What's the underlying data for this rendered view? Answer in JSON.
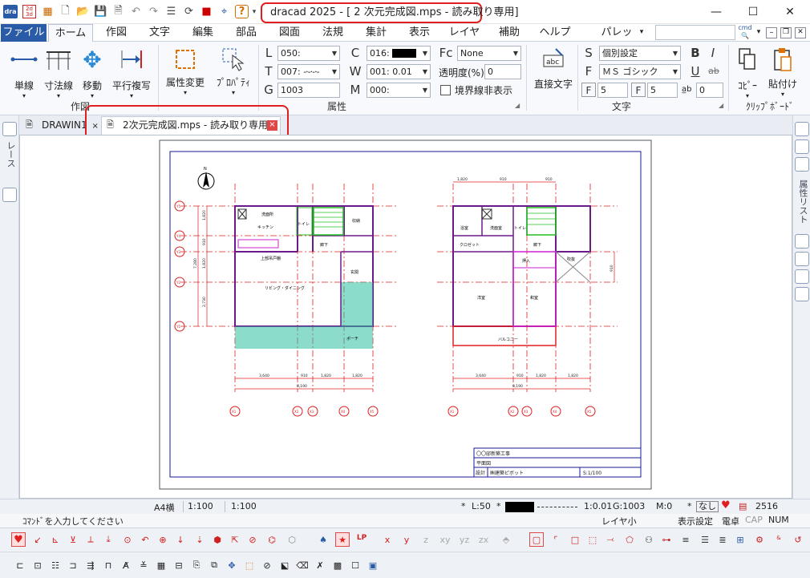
{
  "titlebar": {
    "title": "dracad 2025 - [ 2 次元完成図.mps - 読み取り専用]",
    "minimize": "—",
    "maximize": "☐",
    "close": "✕"
  },
  "menu": {
    "file": "ファイル",
    "tabs": [
      "ホーム",
      "作図",
      "文字",
      "編集",
      "部品",
      "図面",
      "法規",
      "集計",
      "表示",
      "レイヤ",
      "補助",
      "ヘルプ"
    ],
    "palette": "パレット",
    "cmd": "cmd"
  },
  "ribbon": {
    "draw_group": "作図",
    "buttons": {
      "single_line": "単線",
      "dimension": "寸法線",
      "move": "移動",
      "parallel_copy": "平行複写",
      "attr_change": "属性変更",
      "properties": "ﾌﾟﾛﾊﾟﾃｨ",
      "direct_text": "直接文字",
      "copy": "ｺﾋﾟｰ",
      "paste": "貼付け"
    },
    "attr_group": "属性",
    "attr": {
      "L": "L",
      "L_val": "050:",
      "T": "T",
      "T_val": "007:",
      "G": "G",
      "G_val": "1003",
      "C": "C",
      "C_val": "016:",
      "W": "W",
      "W_val": "001: 0.01",
      "M": "M",
      "M_val": "000:",
      "Fc": "Fc",
      "Fc_val": "None",
      "transparency": "透明度(%)",
      "transparency_val": "0",
      "border_hide": "境界線非表示"
    },
    "text_group": "文字",
    "text": {
      "S": "S",
      "S_val": "個別設定",
      "F": "F",
      "F_val": "ＭＳ ゴシック",
      "F1": "F",
      "F1_val": "5",
      "F2": "F",
      "F2_val": "5",
      "ab": "a̲b",
      "ab_val": "0",
      "bold": "B",
      "italic": "I",
      "underline": "U",
      "strike": "ab"
    },
    "clipboard_group": "ｸﾘｯﾌﾟﾎﾞｰﾄﾞ"
  },
  "doctabs": [
    {
      "label": "DRAWIN1"
    },
    {
      "label": "2次元完成図.mps - 読み取り専用"
    }
  ],
  "side": {
    "left": "レース",
    "right": "属性リスト"
  },
  "drawing": {
    "title_block": {
      "project": "〇〇邸新築工事",
      "drawing": "平面図",
      "designer_label": "設計",
      "designer": "㈱建築ピボット",
      "scale": "S:1/100"
    },
    "north": "N",
    "rooms1": [
      "洗面所",
      "キッチン",
      "トイレ",
      "収納",
      "廊下",
      "上部吊戸棚",
      "玄関",
      "リビング・ダイニング",
      "ポーチ"
    ],
    "rooms2": [
      "浴室",
      "洗面室",
      "トイレ",
      "クロゼット",
      "廊下",
      "吹抜",
      "押入",
      "和室",
      "洋室",
      "バルコニー"
    ],
    "dims_top": [
      "1,820",
      "910",
      "910"
    ],
    "dims_bottom": [
      "3,640",
      "910",
      "1,820",
      "1,820",
      "8,190"
    ],
    "dims_left": [
      "1,820",
      "910",
      "1,820",
      "2,730",
      "7,280"
    ],
    "dim_right": "910",
    "grid_x": [
      "X1",
      "X2",
      "X3",
      "X4",
      "X5"
    ],
    "grid_y": [
      "Y5",
      "Y4",
      "Y3",
      "Y2",
      "Y1"
    ]
  },
  "status": {
    "paper": "A4横",
    "scale1": "1:100",
    "scale2": "1:100",
    "star": "*",
    "lscale": "L:50",
    "lw": "1:0.01",
    "g": "G:1003",
    "m": "M:0",
    "nashi": "なし",
    "count": "2516"
  },
  "status2": {
    "prompt": "ｺﾏﾝﾄﾞを入力してください",
    "layer_small": "レイヤ小",
    "display_setting": "表示設定",
    "calc": "電卓",
    "cap": "CAP",
    "num": "NUM"
  },
  "toolbar": {
    "x": "x",
    "y": "y",
    "z": "z",
    "xy": "xy",
    "yz": "yz",
    "zx": "zx",
    "lp": "LP"
  }
}
